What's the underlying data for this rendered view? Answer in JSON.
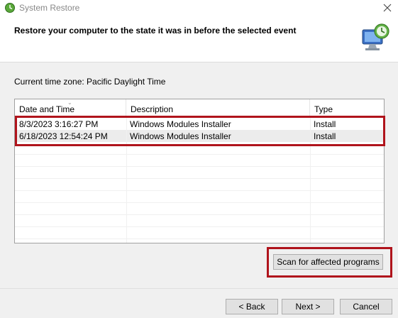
{
  "window": {
    "title": "System Restore"
  },
  "header": {
    "title": "Restore your computer to the state it was in before the selected event"
  },
  "timezone": "Current time zone: Pacific Daylight Time",
  "table": {
    "columns": [
      "Date and Time",
      "Description",
      "Type"
    ],
    "rows": [
      [
        "8/3/2023 3:16:27 PM",
        "Windows Modules Installer",
        "Install"
      ],
      [
        "6/18/2023 12:54:24 PM",
        "Windows Modules Installer",
        "Install"
      ]
    ]
  },
  "buttons": {
    "scan": "Scan for affected programs",
    "back": "< Back",
    "next": "Next >",
    "cancel": "Cancel"
  },
  "colors": {
    "highlight": "#b0141c"
  }
}
